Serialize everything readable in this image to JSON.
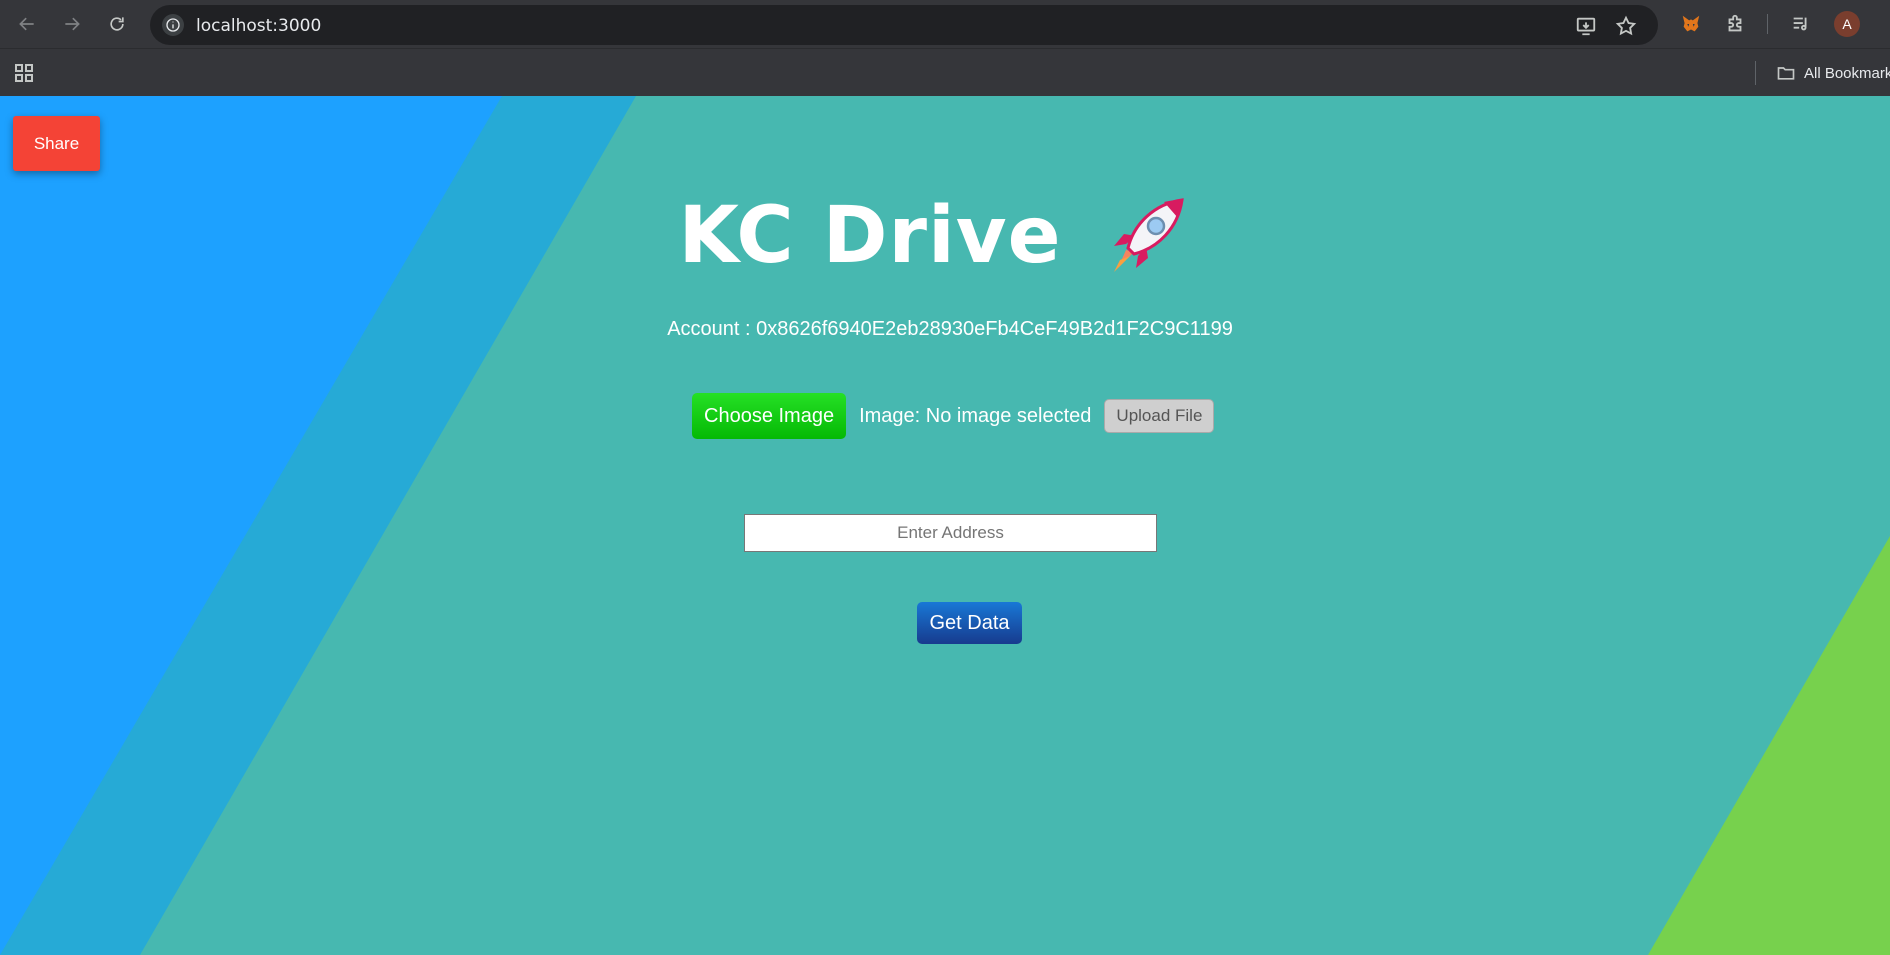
{
  "browser": {
    "url": "localhost:3000",
    "profile_initial": "A",
    "bookmarks_label": "All Bookmarks",
    "icons": [
      "back-arrow-icon",
      "forward-arrow-icon",
      "reload-icon",
      "site-info-icon",
      "install-app-icon",
      "star-icon",
      "metamask-fox-icon",
      "extensions-icon",
      "media-queue-icon",
      "apps-grid-icon",
      "folder-icon"
    ]
  },
  "page": {
    "share_label": "Share",
    "title": "KC Drive",
    "title_emoji": "rocket",
    "account_label": "Account :",
    "account_address": "0x8626f6940E2eb28930eFb4CeF49B2d1F2C9C1199",
    "choose_label": "Choose Image",
    "image_status": "Image: No image selected",
    "upload_label": "Upload File",
    "address_placeholder": "Enter Address",
    "address_value": "",
    "get_data_label": "Get Data"
  },
  "colors": {
    "background_teal": "#47b8b0",
    "background_blue": "#1da1ff",
    "background_green": "#77d14d",
    "share_red": "#f44336",
    "choose_green": "#11cc11",
    "get_data_blue": "#1a56b0"
  }
}
